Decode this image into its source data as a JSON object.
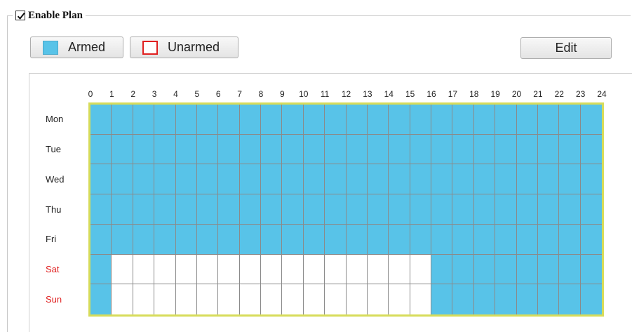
{
  "plan": {
    "enabled": true,
    "label": "Enable Plan"
  },
  "legend_buttons": {
    "armed_label": "Armed",
    "unarmed_label": "Unarmed",
    "edit_label": "Edit"
  },
  "colors": {
    "armed": "#58c3e8",
    "unarmed_border": "#e02020",
    "grid_border": "#d7dc5a",
    "weekend_text": "#e02020"
  },
  "schedule": {
    "hours": [
      "0",
      "1",
      "2",
      "3",
      "4",
      "5",
      "6",
      "7",
      "8",
      "9",
      "10",
      "11",
      "12",
      "13",
      "14",
      "15",
      "16",
      "17",
      "18",
      "19",
      "20",
      "21",
      "22",
      "23",
      "24"
    ],
    "days": [
      {
        "name": "Mon",
        "weekend": false,
        "armed_ranges": [
          [
            0,
            24
          ]
        ]
      },
      {
        "name": "Tue",
        "weekend": false,
        "armed_ranges": [
          [
            0,
            24
          ]
        ]
      },
      {
        "name": "Wed",
        "weekend": false,
        "armed_ranges": [
          [
            0,
            24
          ]
        ]
      },
      {
        "name": "Thu",
        "weekend": false,
        "armed_ranges": [
          [
            0,
            24
          ]
        ]
      },
      {
        "name": "Fri",
        "weekend": false,
        "armed_ranges": [
          [
            0,
            24
          ]
        ]
      },
      {
        "name": "Sat",
        "weekend": true,
        "armed_ranges": [
          [
            0,
            1
          ],
          [
            16,
            24
          ]
        ]
      },
      {
        "name": "Sun",
        "weekend": true,
        "armed_ranges": [
          [
            0,
            1
          ],
          [
            16,
            24
          ]
        ]
      }
    ]
  }
}
